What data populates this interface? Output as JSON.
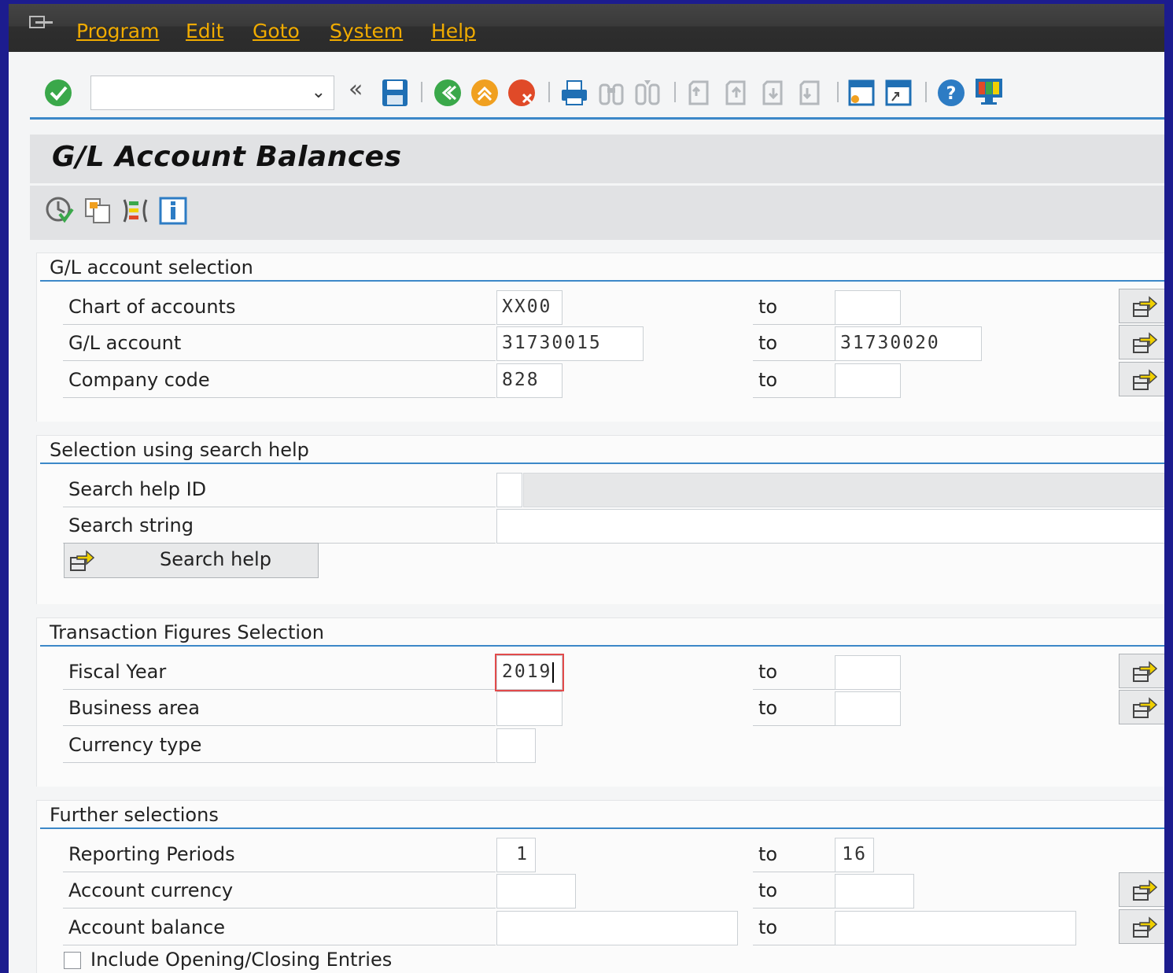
{
  "menu": {
    "items": [
      "Program",
      "Edit",
      "Goto",
      "System",
      "Help"
    ]
  },
  "toolbar": {
    "command_field_value": "",
    "icons": [
      "enter-icon",
      "back-icon",
      "exit-icon",
      "cancel-icon",
      "print-icon",
      "find-icon",
      "find-next-icon",
      "first-page-icon",
      "previous-page-icon",
      "next-page-icon",
      "last-page-icon",
      "create-session-icon",
      "shortcut-icon",
      "help-icon",
      "customize-layout-icon"
    ],
    "colors": {
      "menubar": "#2b2b2b",
      "menu_text": "#f0ab00",
      "accent_rule": "#3c88c8"
    }
  },
  "page": {
    "title": "G/L Account Balances"
  },
  "sections": {
    "gl_selection": {
      "title": "G/L account selection",
      "rows": [
        {
          "label": "Chart of accounts",
          "from": "XX00",
          "to_label": "to",
          "to": ""
        },
        {
          "label": "G/L account",
          "from": "31730015",
          "to_label": "to",
          "to": "31730020"
        },
        {
          "label": "Company code",
          "from": "828",
          "to_label": "to",
          "to": ""
        }
      ]
    },
    "search_help": {
      "title": "Selection using search help",
      "id_label": "Search help ID",
      "id_value": "",
      "id_description": "",
      "string_label": "Search string",
      "string_value": "",
      "button_label": "Search help"
    },
    "transaction_figures": {
      "title": "Transaction Figures Selection",
      "rows": [
        {
          "label": "Fiscal Year",
          "from": "2019",
          "to_label": "to",
          "to": ""
        },
        {
          "label": "Business area",
          "from": "",
          "to_label": "to",
          "to": ""
        },
        {
          "label": "Currency type",
          "from": ""
        }
      ]
    },
    "further": {
      "title": "Further selections",
      "rows": [
        {
          "label": "Reporting Periods",
          "from": "1",
          "to_label": "to",
          "to": "16"
        },
        {
          "label": "Account currency",
          "from": "",
          "to_label": "to",
          "to": ""
        },
        {
          "label": "Account balance",
          "from": "",
          "to_label": "to",
          "to": ""
        }
      ],
      "checkbox_label": "Include Opening/Closing Entries",
      "checkbox_checked": false
    }
  }
}
